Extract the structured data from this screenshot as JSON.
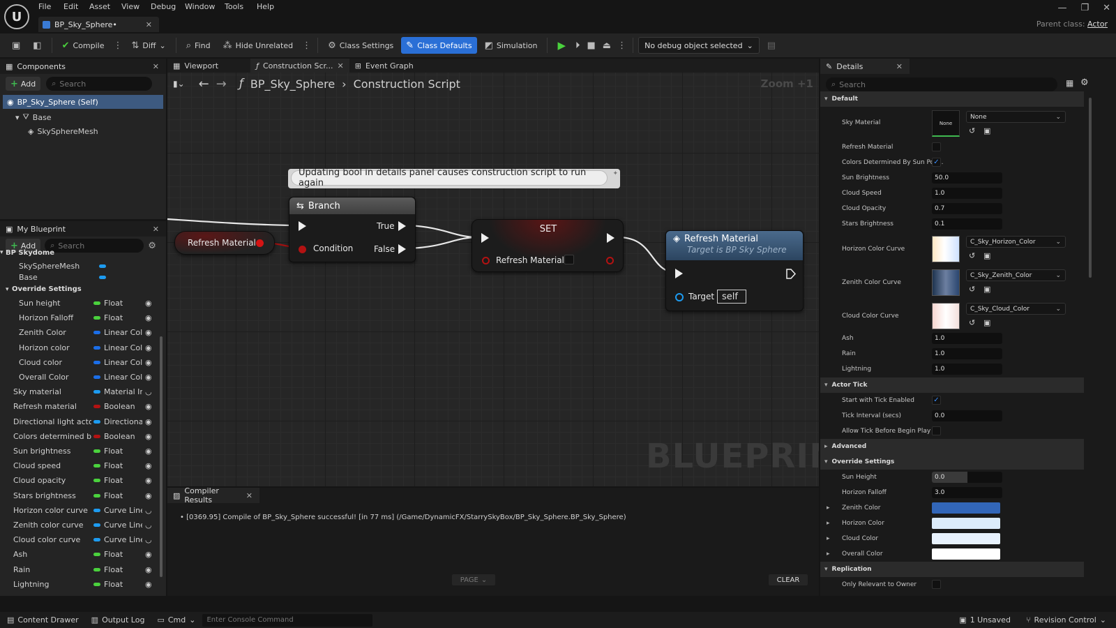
{
  "menu": [
    "File",
    "Edit",
    "Asset",
    "View",
    "Debug",
    "Window",
    "Tools",
    "Help"
  ],
  "doc_tab": {
    "title": "BP_Sky_Sphere•"
  },
  "parent_class": {
    "label": "Parent class:",
    "value": "Actor"
  },
  "toolbar": {
    "compile": "Compile",
    "diff": "Diff",
    "find": "Find",
    "hide_unrelated": "Hide Unrelated",
    "class_settings": "Class Settings",
    "class_defaults": "Class Defaults",
    "simulation": "Simulation",
    "debug_object": "No debug object selected"
  },
  "components": {
    "title": "Components",
    "add": "Add",
    "search_placeholder": "Search",
    "items": [
      "BP_Sky_Sphere (Self)",
      "Base",
      "SkySphereMesh"
    ]
  },
  "my_blueprint": {
    "title": "My Blueprint",
    "add": "Add",
    "search_placeholder": "Search",
    "category_partial": "BP Skydome",
    "vars_top": [
      {
        "name": "SkySphereMesh",
        "color": "#1d9bf0"
      },
      {
        "name": "Base",
        "color": "#1d9bf0"
      }
    ],
    "override_header": "Override Settings",
    "override_vars": [
      {
        "name": "Sun height",
        "type": "Float",
        "color": "#4ad13d"
      },
      {
        "name": "Horizon Falloff",
        "type": "Float",
        "color": "#4ad13d"
      },
      {
        "name": "Zenith Color",
        "type": "Linear Colc",
        "color": "#1b6ee8"
      },
      {
        "name": "Horizon color",
        "type": "Linear Colc",
        "color": "#1b6ee8"
      },
      {
        "name": "Cloud color",
        "type": "Linear Colc",
        "color": "#1b6ee8"
      },
      {
        "name": "Overall Color",
        "type": "Linear Colc",
        "color": "#1b6ee8"
      }
    ],
    "vars": [
      {
        "name": "Sky material",
        "type": "Material Ins",
        "color": "#1d9bf0",
        "eye": "closed"
      },
      {
        "name": "Refresh material",
        "type": "Boolean",
        "color": "#b31212",
        "eye": "open"
      },
      {
        "name": "Directional light actor",
        "type": "Directional",
        "color": "#1d9bf0",
        "eye": "open"
      },
      {
        "name": "Colors determined by s",
        "type": "Boolean",
        "color": "#b31212",
        "eye": "open"
      },
      {
        "name": "Sun brightness",
        "type": "Float",
        "color": "#4ad13d",
        "eye": "open"
      },
      {
        "name": "Cloud speed",
        "type": "Float",
        "color": "#4ad13d",
        "eye": "open"
      },
      {
        "name": "Cloud opacity",
        "type": "Float",
        "color": "#4ad13d",
        "eye": "open"
      },
      {
        "name": "Stars brightness",
        "type": "Float",
        "color": "#4ad13d",
        "eye": "open"
      },
      {
        "name": "Horizon color curve",
        "type": "Curve Linea",
        "color": "#1d9bf0",
        "eye": "closed"
      },
      {
        "name": "Zenith color curve",
        "type": "Curve Linea",
        "color": "#1d9bf0",
        "eye": "closed"
      },
      {
        "name": "Cloud color curve",
        "type": "Curve Linea",
        "color": "#1d9bf0",
        "eye": "closed"
      },
      {
        "name": "Ash",
        "type": "Float",
        "color": "#4ad13d",
        "eye": "open"
      },
      {
        "name": "Rain",
        "type": "Float",
        "color": "#4ad13d",
        "eye": "open"
      },
      {
        "name": "Lightning",
        "type": "Float",
        "color": "#4ad13d",
        "eye": "open"
      }
    ]
  },
  "graph": {
    "tabs": [
      "Viewport",
      "Construction Scr...",
      "Event Graph"
    ],
    "breadcrumb": [
      "BP_Sky_Sphere",
      "Construction Script"
    ],
    "zoom": "Zoom +1",
    "watermark": "BLUEPRINT",
    "comment": "Updating bool in details panel causes construction script to run again",
    "get_node": "Refresh Material",
    "branch": {
      "title": "Branch",
      "true": "True",
      "false": "False",
      "condition": "Condition"
    },
    "set": {
      "title": "SET",
      "pin": "Refresh Material"
    },
    "func": {
      "title": "Refresh Material",
      "subtitle": "Target is BP Sky Sphere",
      "target": "Target",
      "self": "self"
    }
  },
  "compiler": {
    "title": "Compiler Results",
    "message": "[0369.95] Compile of BP_Sky_Sphere successful! [in 77 ms] (/Game/DynamicFX/StarrySkyBox/BP_Sky_Sphere.BP_Sky_Sphere)",
    "page": "PAGE",
    "clear": "CLEAR"
  },
  "details": {
    "title": "Details",
    "search_placeholder": "Search",
    "default_section": "Default",
    "sky_material": {
      "label": "Sky Material",
      "thumb": "None",
      "value": "None"
    },
    "refresh_material": "Refresh Material",
    "colors_determined": "Colors Determined By Sun Pos...",
    "fields": [
      {
        "label": "Sun Brightness",
        "value": "50.0"
      },
      {
        "label": "Cloud Speed",
        "value": "1.0"
      },
      {
        "label": "Cloud Opacity",
        "value": "0.7"
      },
      {
        "label": "Stars Brightness",
        "value": "0.1"
      }
    ],
    "curves": [
      {
        "label": "Horizon Color Curve",
        "value": "C_Sky_Horizon_Color"
      },
      {
        "label": "Zenith Color Curve",
        "value": "C_Sky_Zenith_Color"
      },
      {
        "label": "Cloud Color Curve",
        "value": "C_Sky_Cloud_Color"
      }
    ],
    "fields2": [
      {
        "label": "Ash",
        "value": "1.0"
      },
      {
        "label": "Rain",
        "value": "1.0"
      },
      {
        "label": "Lightning",
        "value": "1.0"
      }
    ],
    "actor_tick": "Actor Tick",
    "start_tick": "Start with Tick Enabled",
    "tick_interval": {
      "label": "Tick Interval (secs)",
      "value": "0.0"
    },
    "allow_tick": "Allow Tick Before Begin Play",
    "advanced": "Advanced",
    "override_section": "Override Settings",
    "sun_height": {
      "label": "Sun Height",
      "value": "0.0",
      "fraction": 0.5
    },
    "horizon_falloff": {
      "label": "Horizon Falloff",
      "value": "3.0"
    },
    "colors": [
      {
        "label": "Zenith Color",
        "color": "#3266b8"
      },
      {
        "label": "Horizon Color",
        "color": "#dcecfb"
      },
      {
        "label": "Cloud Color",
        "color": "#e8f2fd"
      },
      {
        "label": "Overall Color",
        "color": "#ffffff"
      }
    ],
    "replication": "Replication",
    "only_relevant": "Only Relevant to Owner"
  },
  "status": {
    "content_drawer": "Content Drawer",
    "output_log": "Output Log",
    "cmd": "Cmd",
    "console_placeholder": "Enter Console Command",
    "unsaved": "1 Unsaved",
    "revision": "Revision Control"
  }
}
